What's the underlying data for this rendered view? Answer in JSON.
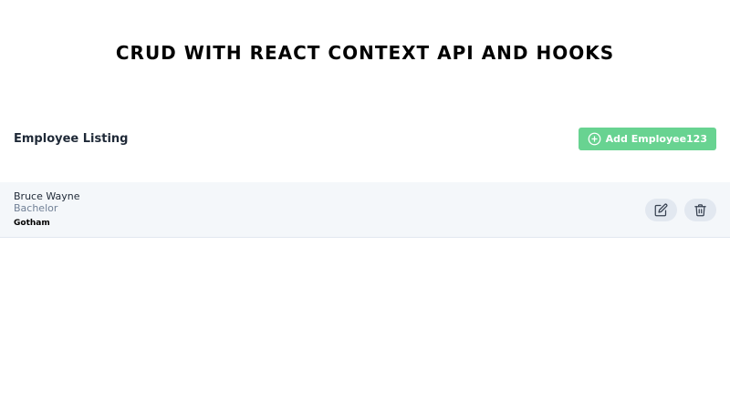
{
  "header": {
    "title": "CRUD WITH REACT CONTEXT API AND HOOKS"
  },
  "listing": {
    "heading": "Employee Listing",
    "add_button_label": "Add Employee123",
    "add_button_icon": "plus-circle-icon",
    "add_button_color": "#68d391"
  },
  "employees": [
    {
      "name": "Bruce Wayne",
      "designation": "Bachelor",
      "location": "Gotham",
      "edit_icon": "edit-icon",
      "delete_icon": "trash-icon"
    }
  ]
}
